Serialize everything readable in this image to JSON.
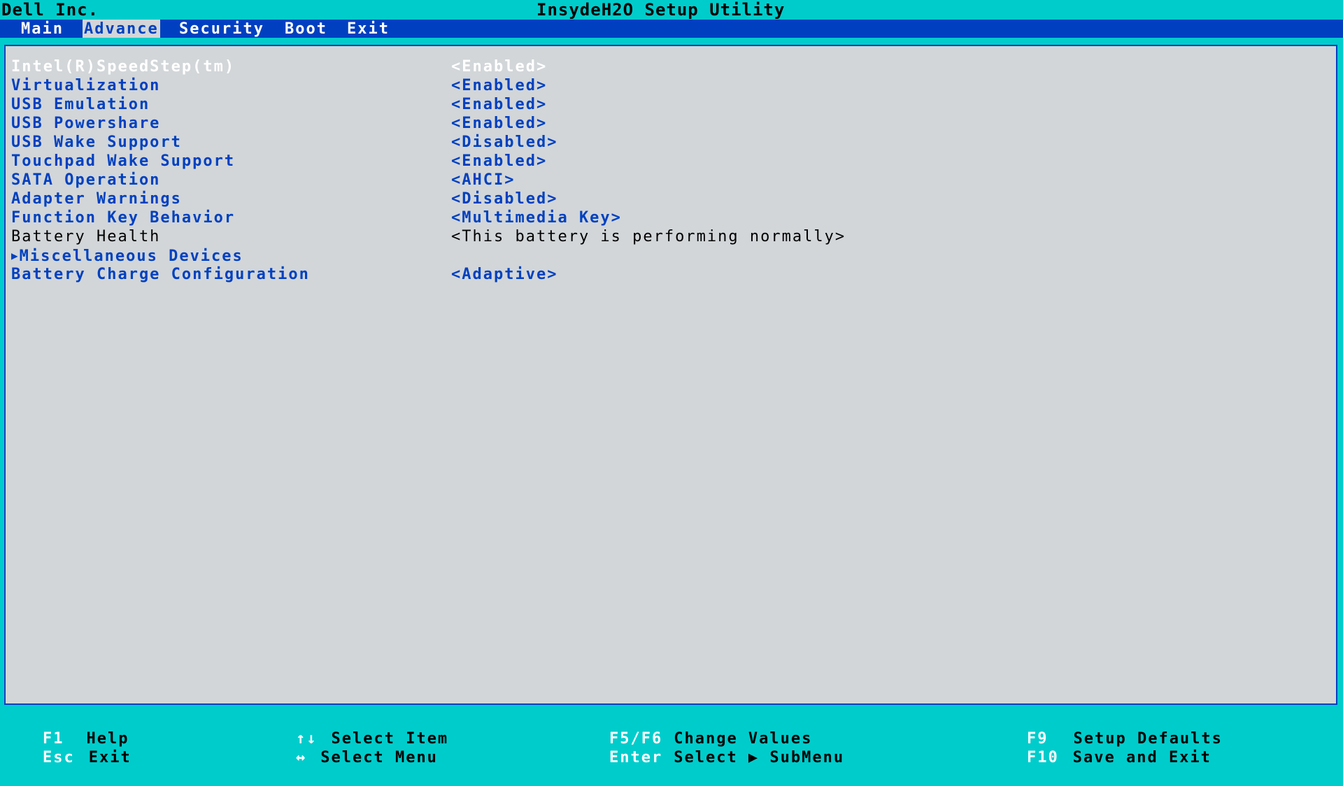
{
  "header": {
    "vendor": "Dell Inc.",
    "title": "InsydeH2O Setup Utility"
  },
  "tabs": [
    {
      "label": "Main",
      "active": false
    },
    {
      "label": "Advance",
      "active": true
    },
    {
      "label": "Security",
      "active": false
    },
    {
      "label": "Boot",
      "active": false
    },
    {
      "label": "Exit",
      "active": false
    }
  ],
  "items": [
    {
      "label": "Intel(R)SpeedStep(tm)",
      "value": "<Enabled>"
    },
    {
      "label": "Virtualization",
      "value": "<Enabled>"
    },
    {
      "label": "USB Emulation",
      "value": "<Enabled>"
    },
    {
      "label": "USB Powershare",
      "value": "<Enabled>"
    },
    {
      "label": "USB Wake Support",
      "value": "<Disabled>"
    },
    {
      "label": "Touchpad Wake Support",
      "value": "<Enabled>"
    },
    {
      "label": "SATA Operation",
      "value": "<AHCI>"
    },
    {
      "label": "Adapter Warnings",
      "value": "<Disabled>"
    },
    {
      "label": "Function Key Behavior",
      "value": "<Multimedia Key>"
    },
    {
      "label": "Battery Health",
      "value": "<This battery is performing normally>"
    },
    {
      "label": "Miscellaneous Devices",
      "value": ""
    },
    {
      "label": "Battery Charge Configuration",
      "value": "<Adaptive>"
    }
  ],
  "footer": {
    "f1_key": "F1",
    "f1_desc": "Help",
    "esc_key": "Esc",
    "esc_desc": "Exit",
    "updown_key": "↑↓",
    "updown_desc": "Select Item",
    "leftright_key": "↔",
    "leftright_desc": "Select Menu",
    "f5f6_key": "F5/F6",
    "f5f6_desc": "Change Values",
    "enter_key": "Enter",
    "enter_desc": "Select ▶ SubMenu",
    "f9_key": "F9",
    "f9_desc": "Setup Defaults",
    "f10_key": "F10",
    "f10_desc": "Save and Exit"
  },
  "colors": {
    "frame": "#00cccc",
    "menubar": "#0040c0",
    "panel": "#d2d6d9",
    "item_text": "#0040c0",
    "selected_text": "#ffffff",
    "info_text": "#000000"
  }
}
